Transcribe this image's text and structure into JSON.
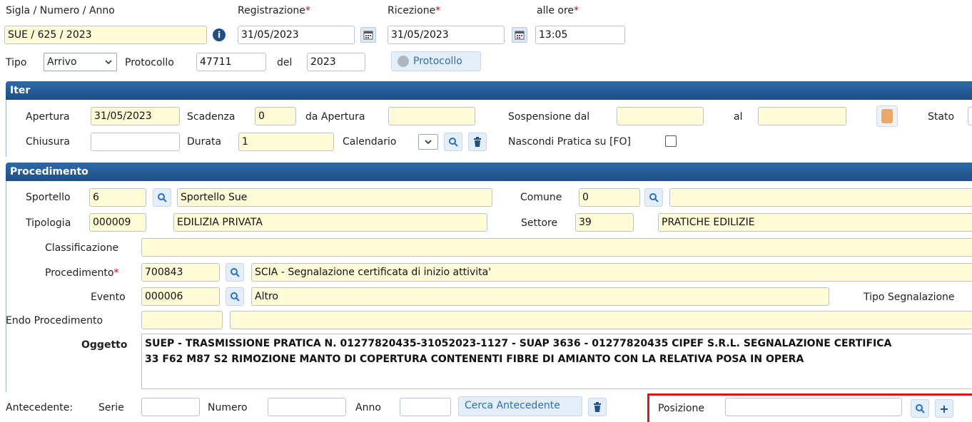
{
  "top": {
    "sigla_label": "Sigla / Numero / Anno",
    "sigla_value": "SUE / 625 / 2023",
    "registrazione_label": "Registrazione",
    "registrazione_value": "31/05/2023",
    "ricezione_label": "Ricezione",
    "ricezione_value": "31/05/2023",
    "alle_ore_label": "alle ore",
    "alle_ore_value": "13:05",
    "required_mark": "*",
    "tipo_label": "Tipo",
    "tipo_value": "Arrivo",
    "protocollo_label": "Protocollo",
    "protocollo_value": "47711",
    "del_label": "del",
    "del_value": "2023",
    "protocollo_button": "Protocollo"
  },
  "iter": {
    "title": "Iter",
    "apertura_label": "Apertura",
    "apertura_value": "31/05/2023",
    "scadenza_label": "Scadenza",
    "scadenza_value": "0",
    "da_apertura_label": "da Apertura",
    "da_apertura_value": "",
    "sospensione_label": "Sospensione dal",
    "sospensione_value": "",
    "al_label": "al",
    "al_value": "",
    "stato_label": "Stato",
    "chiusura_label": "Chiusura",
    "chiusura_value": "",
    "durata_label": "Durata",
    "durata_value": "1",
    "calendario_label": "Calendario",
    "nascondi_label": "Nascondi Pratica su [FO]"
  },
  "procedimento": {
    "title": "Procedimento",
    "sportello_label": "Sportello",
    "sportello_code": "6",
    "sportello_desc": "Sportello Sue",
    "comune_label": "Comune",
    "comune_code": "0",
    "comune_desc": "",
    "tipologia_label": "Tipologia",
    "tipologia_code": "000009",
    "tipologia_desc": "EDILIZIA PRIVATA",
    "settore_label": "Settore",
    "settore_code": "39",
    "settore_desc": "PRATICHE EDILIZIE",
    "classificazione_label": "Classificazione",
    "classificazione_value": "",
    "procedimento_label": "Procedimento",
    "procedimento_code": "700843",
    "procedimento_desc": "SCIA - Segnalazione certificata di inizio attivita'",
    "evento_label": "Evento",
    "evento_code": "000006",
    "evento_desc": "Altro",
    "tipo_segnalazione_label": "Tipo Segnalazione",
    "endo_label": "Endo Procedimento",
    "oggetto_label": "Oggetto",
    "oggetto_line1": "SUEP - TRASMISSIONE PRATICA N. 01277820435-31052023-1127 - SUAP 3636 - 01277820435 CIPEF S.R.L. SEGNALAZIONE CERTIFICA",
    "oggetto_line2": "33 F62 M87 S2 RIMOZIONE MANTO DI COPERTURA CONTENENTI FIBRE DI AMIANTO CON LA RELATIVA POSA IN OPERA"
  },
  "antecedente": {
    "label": "Antecedente:",
    "serie_label": "Serie",
    "numero_label": "Numero",
    "anno_label": "Anno",
    "cerca_button": "Cerca Antecedente",
    "posizione_label": "Posizione",
    "plus_label": "+"
  },
  "colors": {
    "field_yellow": "#fffbd6",
    "header_blue": "#1d4f86",
    "highlight_red": "#d21b1b"
  }
}
